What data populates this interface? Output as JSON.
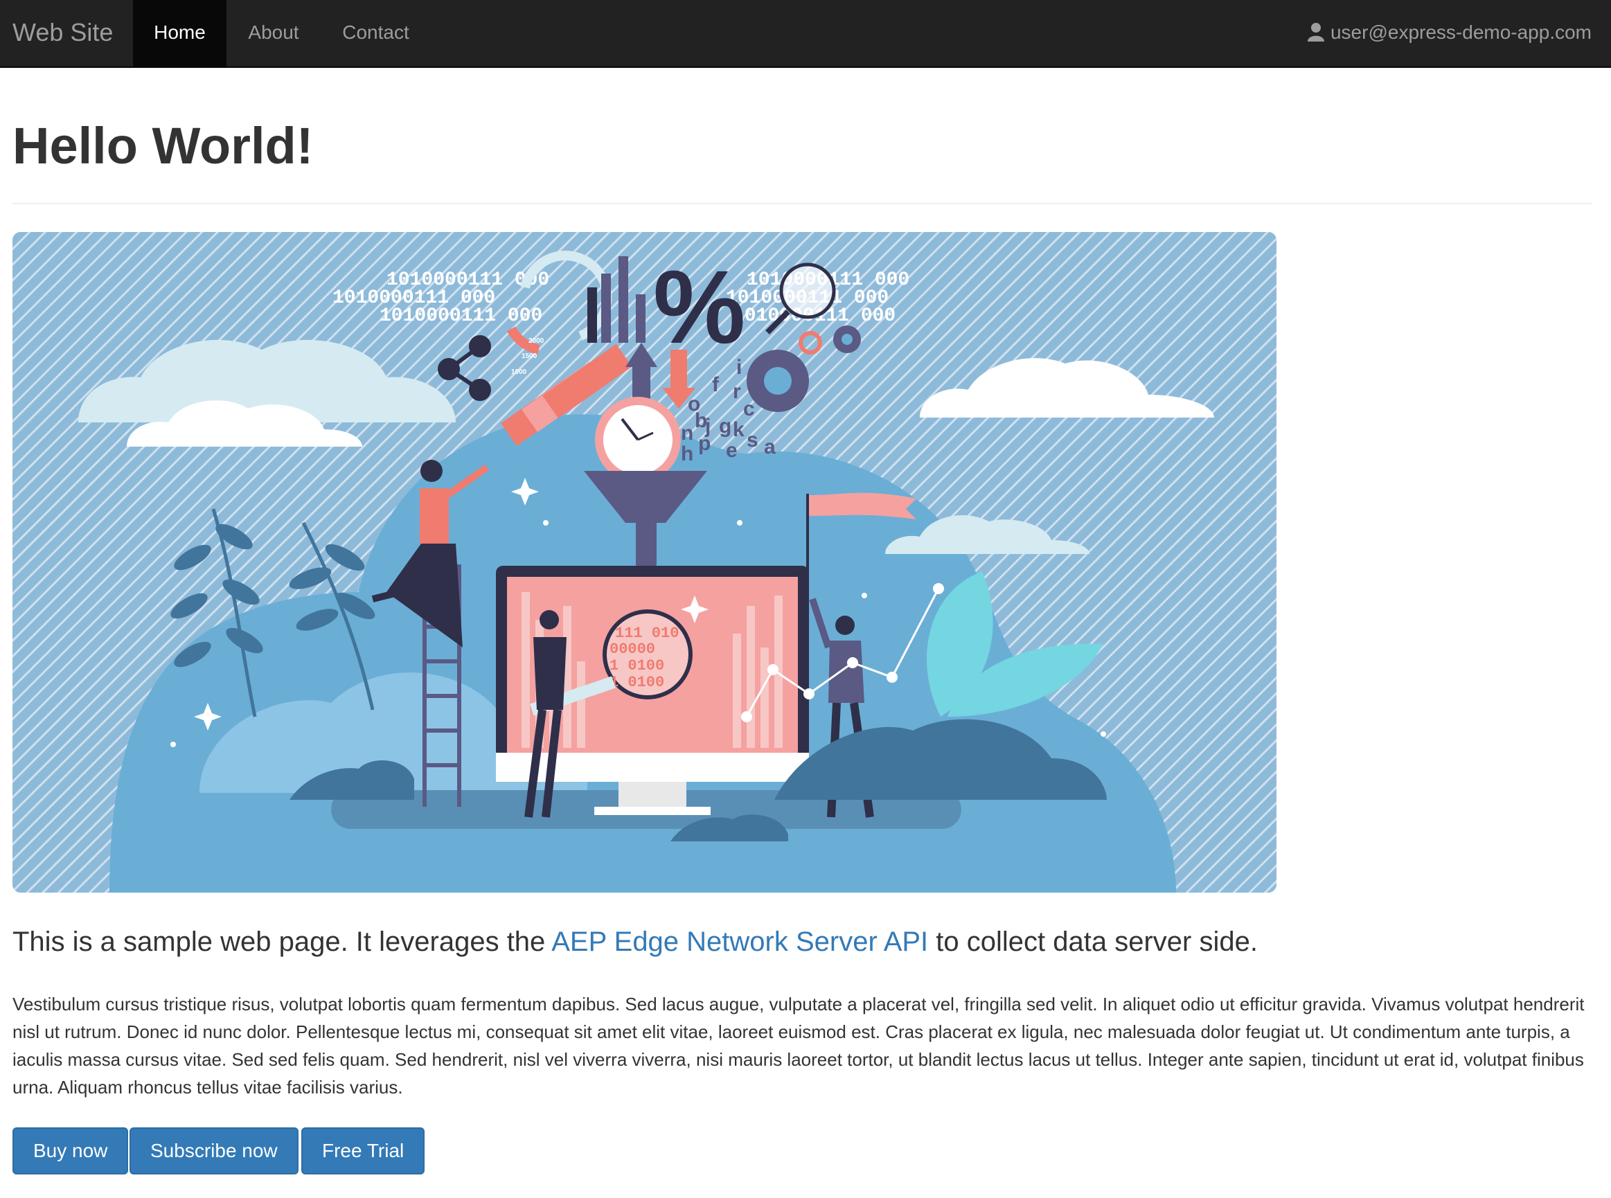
{
  "navbar": {
    "brand": "Web Site",
    "items": [
      {
        "label": "Home",
        "active": true
      },
      {
        "label": "About",
        "active": false
      },
      {
        "label": "Contact",
        "active": false
      }
    ],
    "user_email": "user@express-demo-app.com",
    "user_icon": "user-icon"
  },
  "main": {
    "title": "Hello World!",
    "lead_before": "This is a sample web page. It leverages the ",
    "lead_link": "AEP Edge Network Server API",
    "lead_after": " to collect data server side.",
    "body": "Vestibulum cursus tristique risus, volutpat lobortis quam fermentum dapibus. Sed lacus augue, vulputate a placerat vel, fringilla sed velit. In aliquet odio ut efficitur gravida. Vivamus volutpat hendrerit nisl ut rutrum. Donec id nunc dolor. Pellentesque lectus mi, consequat sit amet elit vitae, laoreet euismod est. Cras placerat ex ligula, nec malesuada dolor feugiat ut. Ut condimentum ante turpis, a iaculis massa cursus vitae. Sed sed felis quam. Sed hendrerit, nisl vel viverra viverra, nisi mauris laoreet tortor, ut blandit lectus lacus ut tellus. Integer ante sapien, tincidunt ut erat id, volutpat finibus urna. Aliquam rhoncus tellus vitae facilisis varius.",
    "buttons": [
      "Buy now",
      "Subscribe now",
      "Free Trial"
    ]
  },
  "hero": {
    "binary_rows": [
      "1010000111 000",
      "1010000111 000",
      "1010000111 000"
    ],
    "binary_rows_right": [
      "1010000111 000",
      "1010000111 000",
      "1010000111 000"
    ],
    "percent": "%",
    "magnifier_text": [
      "111 010",
      "00000",
      "1 0100",
      "1 0100"
    ],
    "scale_labels": [
      "2000",
      "1500",
      "1000"
    ],
    "letters": [
      "f",
      "i",
      "r",
      "c",
      "o",
      "b",
      "j",
      "g",
      "k",
      "s",
      "a",
      "n",
      "h",
      "p",
      "e"
    ],
    "accent_pink": "#f4a1a0",
    "accent_blue": "#6aaed6",
    "dark_navy": "#2f2f4a"
  },
  "colors": {
    "navbar": "#222222",
    "link": "#337ab7",
    "button": "#337ab7"
  }
}
